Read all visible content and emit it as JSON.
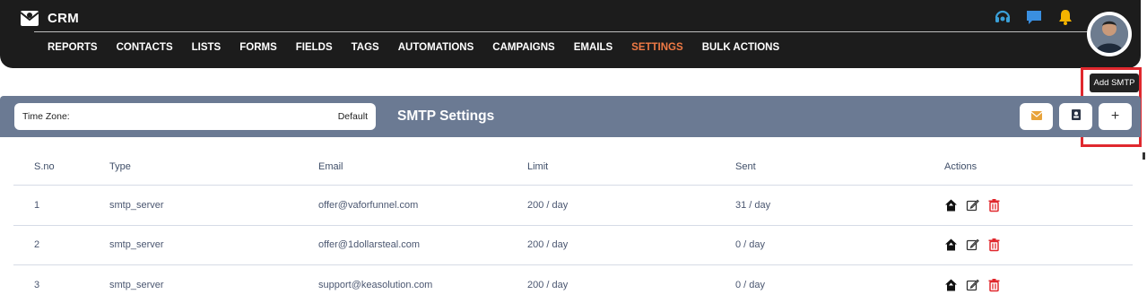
{
  "brand": {
    "name": "CRM"
  },
  "nav": {
    "items": [
      {
        "label": "REPORTS",
        "active": false
      },
      {
        "label": "CONTACTS",
        "active": false
      },
      {
        "label": "LISTS",
        "active": false
      },
      {
        "label": "FORMS",
        "active": false
      },
      {
        "label": "FIELDS",
        "active": false
      },
      {
        "label": "TAGS",
        "active": false
      },
      {
        "label": "AUTOMATIONS",
        "active": false
      },
      {
        "label": "CAMPAIGNS",
        "active": false
      },
      {
        "label": "EMAILS",
        "active": false
      },
      {
        "label": "SETTINGS",
        "active": true
      },
      {
        "label": "BULK ACTIONS",
        "active": false
      }
    ],
    "icons": [
      "headset-icon",
      "chat-icon",
      "bell-icon"
    ]
  },
  "tooltip": {
    "text": "Add SMTP"
  },
  "header": {
    "timezone_label": "Time Zone:",
    "timezone_value": "Default",
    "title": "SMTP Settings",
    "plus_label": "+"
  },
  "table": {
    "columns": [
      "S.no",
      "Type",
      "Email",
      "Limit",
      "Sent",
      "Actions"
    ],
    "rows": [
      {
        "sno": "1",
        "type": "smtp_server",
        "email": "offer@vaforfunnel.com",
        "limit": "200 / day",
        "sent": "31 / day"
      },
      {
        "sno": "2",
        "type": "smtp_server",
        "email": "offer@1dollarsteal.com",
        "limit": "200 / day",
        "sent": "0 / day"
      },
      {
        "sno": "3",
        "type": "smtp_server",
        "email": "support@keasolution.com",
        "limit": "200 / day",
        "sent": "0 / day"
      }
    ]
  },
  "colors": {
    "topbar": "#1c1c1c",
    "active_nav": "#f07a45",
    "panel_header": "#6b7a93",
    "highlight": "#e0282e",
    "delete": "#e0282e",
    "mail_icon": "#e8a33a"
  }
}
